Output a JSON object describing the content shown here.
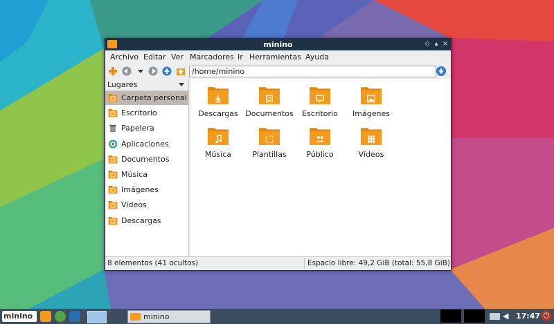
{
  "window": {
    "title": "minino",
    "controls": {
      "restore": "⬦",
      "maximize": "▴",
      "close": "×"
    }
  },
  "menubar": [
    "Archivo",
    "Editar",
    "Ver",
    "Marcadores",
    "Ir",
    "Herramientas",
    "Ayuda"
  ],
  "toolbar": {
    "path": "/home/minino",
    "icons": [
      "new-tab-icon",
      "back-icon",
      "history-dropdown-icon",
      "forward-icon",
      "up-icon",
      "home-icon",
      "go-icon"
    ]
  },
  "sidebar": {
    "header": "Lugares",
    "items": [
      {
        "label": "Carpeta personal",
        "icon": "home-folder-icon",
        "selected": true
      },
      {
        "label": "Escritorio",
        "icon": "desktop-folder-icon"
      },
      {
        "label": "Papelera",
        "icon": "trash-icon"
      },
      {
        "label": "Aplicaciones",
        "icon": "applications-icon"
      },
      {
        "label": "Documentos",
        "icon": "documents-folder-icon"
      },
      {
        "label": "Música",
        "icon": "music-folder-icon"
      },
      {
        "label": "Imágenes",
        "icon": "pictures-folder-icon"
      },
      {
        "label": "Vídeos",
        "icon": "videos-folder-icon"
      },
      {
        "label": "Descargas",
        "icon": "downloads-folder-icon"
      }
    ]
  },
  "files": [
    {
      "label": "Descargas",
      "icon": "downloads-folder-icon"
    },
    {
      "label": "Documentos",
      "icon": "documents-folder-icon"
    },
    {
      "label": "Escritorio",
      "icon": "desktop-folder-icon"
    },
    {
      "label": "Imágenes",
      "icon": "pictures-folder-icon"
    },
    {
      "label": "Música",
      "icon": "music-folder-icon"
    },
    {
      "label": "Plantillas",
      "icon": "templates-folder-icon"
    },
    {
      "label": "Público",
      "icon": "public-folder-icon"
    },
    {
      "label": "Vídeos",
      "icon": "videos-folder-icon"
    }
  ],
  "status": {
    "left": "8 elementos (41 ocultos)",
    "right": "Espacio libre: 49,2 GiB (total: 55,8 GiB)"
  },
  "taskbar": {
    "logo": "minino",
    "task_label": "minino",
    "clock": "17:47"
  },
  "colors": {
    "folder": "#f49b1d",
    "titlebar": "#1e3145",
    "selection": "#c1b9b1",
    "taskbar": "#3b4d5f"
  }
}
